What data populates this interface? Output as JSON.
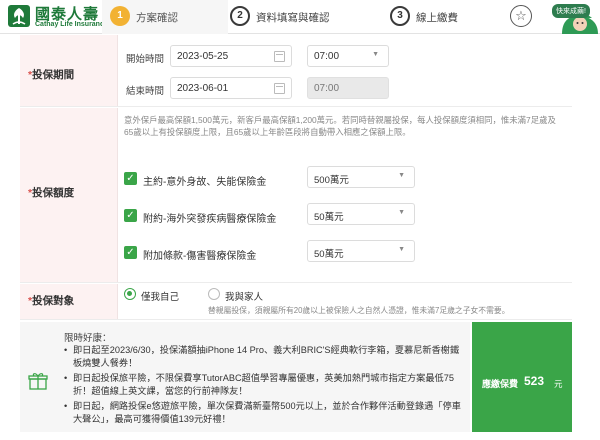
{
  "brand": {
    "name_cn": "國泰人壽",
    "name_en": "Cathay Life Insurance",
    "color": "#1f7a3a"
  },
  "steps": [
    {
      "num": "1",
      "label": "方案確認"
    },
    {
      "num": "2",
      "label": "資料填寫與確認"
    },
    {
      "num": "3",
      "label": "線上繳費"
    }
  ],
  "header": {
    "favorite_icon": "star-icon",
    "mascot_bubble": "快來成繭!"
  },
  "period": {
    "label": "投保期間",
    "start_label": "開始時間",
    "start_date": "2023-05-25",
    "start_time": "07:00",
    "end_label": "結束時間",
    "end_date": "2023-06-01",
    "end_time": "07:00"
  },
  "amount": {
    "label": "投保額度",
    "note": "意外保戶最高保額1,500萬元，新客戶最高保額1,200萬元。若同時替親屬投保，每人投保額度須相同，惟未滿7足歲及65歲以上有投保額度上限，且65歲以上年齡區段將自動帶入相應之保額上限。",
    "coverages": [
      {
        "name": "主約-意外身故、失能保險金",
        "amount": "500萬元"
      },
      {
        "name": "附約-海外突發疾病醫療保險金",
        "amount": "50萬元"
      },
      {
        "name": "附加條款-傷害醫療保險金",
        "amount": "50萬元"
      }
    ]
  },
  "target": {
    "label": "投保對象",
    "option_self": "僅我自己",
    "option_family": "我與家人",
    "note": "替親屬投保，須親屬所有20歲以上被保險人之自然人憑證，惟未滿7足歲之子女不需要。"
  },
  "promo": {
    "title": "限時好康：",
    "items": [
      "即日起至2023/6/30，投保滿額抽iPhone 14 Pro、義大利BRIC'S經典軟行李箱，夏慕尼新香榭鐵板燒雙人餐券！",
      "即日起投保旅平險，不限保費享TutorABC超值學習專屬優惠，英美加熱門城市指定方案最低75折！超值線上英文課，當您的行前神隊友！",
      "即日起，網路投保e悠遊旅平險，單次保費滿新臺幣500元以上，並於合作夥伴活動登錄遇「停車大聲公」，最高可獲得價值139元好禮！"
    ]
  },
  "payment": {
    "label": "應繳保費",
    "value": "523",
    "unit": "元"
  }
}
